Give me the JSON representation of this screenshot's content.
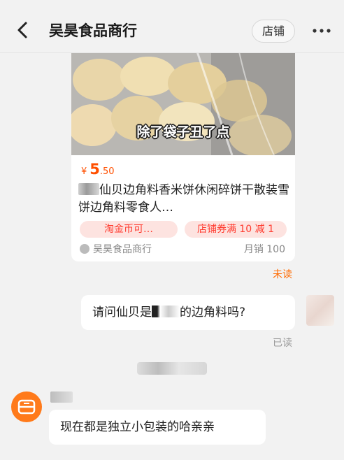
{
  "header": {
    "title": "吴昊食品商行",
    "shop_button": "店铺",
    "back_icon": "chevron-left-icon",
    "more_icon": "more-dots-icon"
  },
  "product_card": {
    "image_caption": "除了袋子丑了点",
    "price_currency": "¥",
    "price_int": "5",
    "price_dec": ".50",
    "title_text": "仙贝边角料香米饼休闲碎饼干散装雪饼边角料零食人…",
    "tags": [
      "淘金币可…",
      "店铺券满 10 减 1"
    ],
    "shop_name": "吴昊食品商行",
    "sales": "月销 100"
  },
  "messages": {
    "status_unread": "未读",
    "outgoing_prefix": "请问仙贝是",
    "outgoing_suffix": "的边角料吗?",
    "status_read": "已读",
    "incoming_text": "现在都是独立小包装的哈亲亲"
  },
  "colors": {
    "accent": "#ff4f00",
    "tag_bg": "#fde3e0",
    "tag_text": "#ff3a2e",
    "shop_avatar": "#ff7a1a"
  }
}
